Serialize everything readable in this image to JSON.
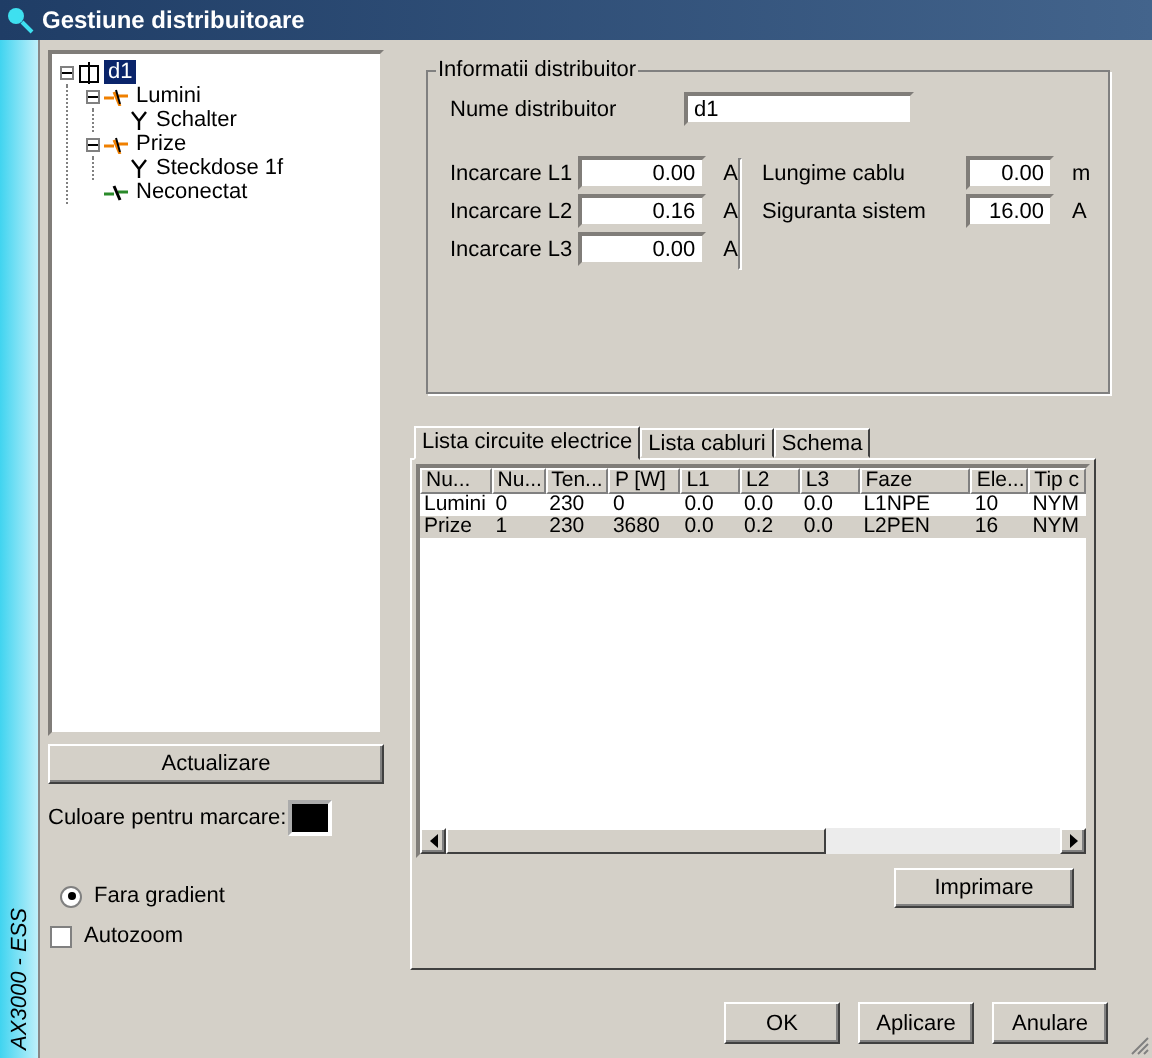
{
  "window": {
    "title": "Gestiune distribuitoare"
  },
  "side_label": "AX3000 - ESS",
  "tree": [
    {
      "label": "d1",
      "kind": "distributor",
      "selected": true,
      "expanded": true,
      "children": [
        {
          "label": "Lumini",
          "kind": "circuit",
          "selected": false,
          "expanded": true,
          "children": [
            {
              "label": "Schalter",
              "kind": "consumer",
              "selected": false
            }
          ]
        },
        {
          "label": "Prize",
          "kind": "circuit",
          "selected": false,
          "expanded": true,
          "children": [
            {
              "label": "Steckdose 1f",
              "kind": "consumer",
              "selected": false
            }
          ]
        },
        {
          "label": "Neconectat",
          "kind": "unconnected",
          "selected": false
        }
      ]
    }
  ],
  "refresh_button": "Actualizare",
  "marking_color": {
    "label": "Culoare pentru marcare:",
    "color": "#000000"
  },
  "gradient_radio": {
    "label": "Fara gradient",
    "selected": true
  },
  "autozoom": {
    "label": "Autozoom",
    "checked": false
  },
  "info_group": {
    "title": "Informatii distribuitor",
    "name_label": "Nume distribuitor",
    "name_value": "d1",
    "loads": [
      {
        "label": "Incarcare L1",
        "value": "0.00",
        "unit": "A"
      },
      {
        "label": "Incarcare L2",
        "value": "0.16",
        "unit": "A"
      },
      {
        "label": "Incarcare L3",
        "value": "0.00",
        "unit": "A"
      }
    ],
    "cable": [
      {
        "label": "Lungime cablu",
        "value": "0.00",
        "unit": "m"
      },
      {
        "label": "Siguranta sistem",
        "value": "16.00",
        "unit": "A"
      }
    ]
  },
  "tabs": [
    {
      "label": "Lista circuite electrice",
      "selected": true
    },
    {
      "label": "Lista cabluri",
      "selected": false
    },
    {
      "label": "Schema",
      "selected": false
    }
  ],
  "table": {
    "columns": [
      "Nu...",
      "Nu...",
      "Ten...",
      "P [W]",
      "L1",
      "L2",
      "L3",
      "Faze",
      "Ele...",
      "Tip c"
    ],
    "rows": [
      {
        "cells": [
          "Lumini",
          "0",
          "230",
          "0",
          "0.0",
          "0.0",
          "0.0",
          "L1NPE",
          "10",
          "NYM"
        ],
        "selected": false
      },
      {
        "cells": [
          "Prize",
          "1",
          "230",
          "3680",
          "0.0",
          "0.2",
          "0.0",
          "L2PEN",
          "16",
          "NYM"
        ],
        "selected": true
      }
    ]
  },
  "print_button": "Imprimare",
  "buttons": [
    "OK",
    "Aplicare",
    "Anulare"
  ]
}
